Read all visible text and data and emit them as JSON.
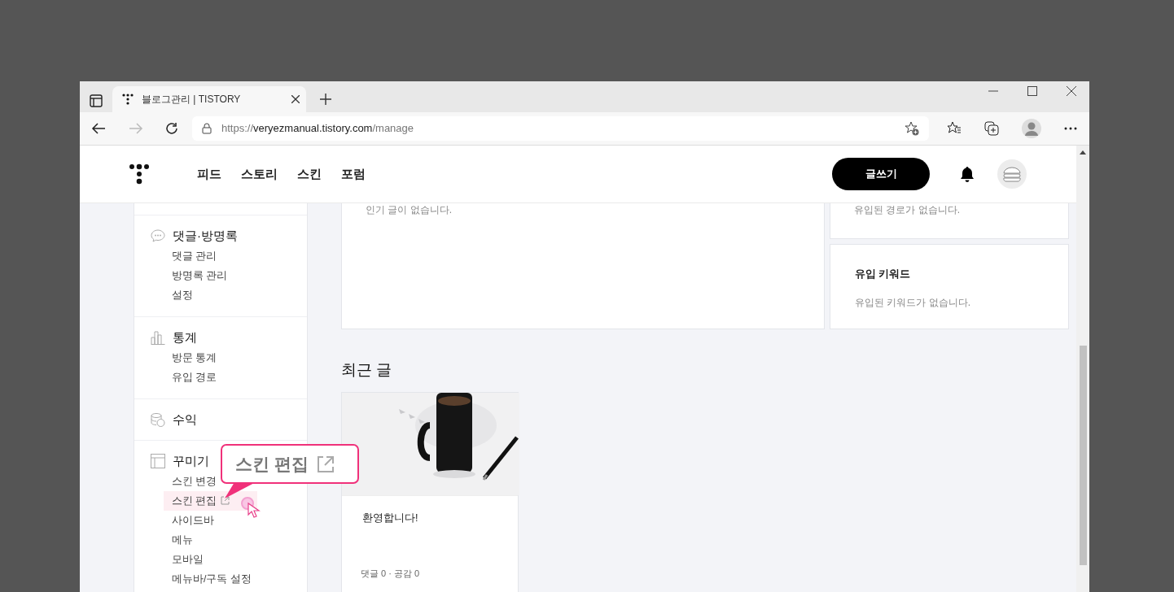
{
  "browser": {
    "tab": {
      "title": "블로그관리 | TISTORY",
      "selected": true
    },
    "address": {
      "scheme": "https://",
      "host": "veryezmanual.tistory.com",
      "path": "/manage"
    }
  },
  "header": {
    "nav": [
      "피드",
      "스토리",
      "스킨",
      "포럼"
    ],
    "write_button": "글쓰기"
  },
  "sidebar": {
    "sections": [
      {
        "kind": "comment",
        "title": "댓글·방명록",
        "items": [
          {
            "label": "댓글 관리",
            "selected": false
          },
          {
            "label": "방명록 관리",
            "selected": false
          },
          {
            "label": "설정",
            "selected": false
          }
        ]
      },
      {
        "kind": "chart",
        "title": "통계",
        "items": [
          {
            "label": "방문 통계",
            "selected": false
          },
          {
            "label": "유입 경로",
            "selected": false
          }
        ]
      },
      {
        "kind": "coins",
        "title": "수익"
      },
      {
        "kind": "layout",
        "title": "꾸미기",
        "items": [
          {
            "label": "스킨 변경",
            "selected": false
          },
          {
            "label": "스킨 편집",
            "selected": true,
            "external": true
          },
          {
            "label": "사이드바",
            "selected": false
          },
          {
            "label": "메뉴",
            "selected": false
          },
          {
            "label": "모바일",
            "selected": false
          },
          {
            "label": "메뉴바/구독 설정",
            "selected": false
          }
        ]
      }
    ]
  },
  "main": {
    "popular_empty": "인기 글이 없습니다.",
    "referrers_empty": "유입된 경로가 없습니다.",
    "keywords": {
      "title": "유입 키워드",
      "empty": "유입된 키워드가 없습니다."
    },
    "recent_title": "최근 글",
    "posts": [
      {
        "kind": "picture",
        "title": "환영합니다!",
        "stats": "댓글 0 · 공감 0"
      }
    ]
  },
  "callout": {
    "text": "스킨 편집"
  }
}
